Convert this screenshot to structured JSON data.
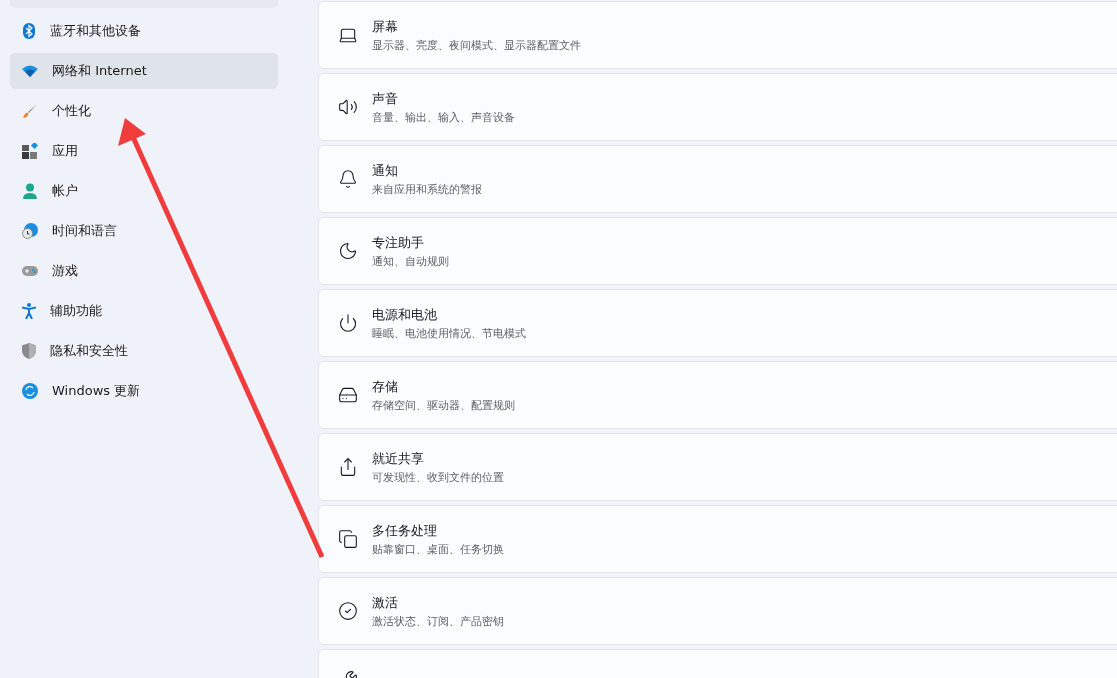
{
  "sidebar": {
    "items": [
      {
        "label": "蓝牙和其他设备",
        "selected": false
      },
      {
        "label": "网络和 Internet",
        "selected": true
      },
      {
        "label": "个性化",
        "selected": false
      },
      {
        "label": "应用",
        "selected": false
      },
      {
        "label": "帐户",
        "selected": false
      },
      {
        "label": "时间和语言",
        "selected": false
      },
      {
        "label": "游戏",
        "selected": false
      },
      {
        "label": "辅助功能",
        "selected": false
      },
      {
        "label": "隐私和安全性",
        "selected": false
      },
      {
        "label": "Windows 更新",
        "selected": false
      }
    ]
  },
  "settings": [
    {
      "title": "屏幕",
      "subtitle": "显示器、亮度、夜间模式、显示器配置文件"
    },
    {
      "title": "声音",
      "subtitle": "音量、输出、输入、声音设备"
    },
    {
      "title": "通知",
      "subtitle": "来自应用和系统的警报"
    },
    {
      "title": "专注助手",
      "subtitle": "通知、自动规则"
    },
    {
      "title": "电源和电池",
      "subtitle": "睡眠、电池使用情况、节电模式"
    },
    {
      "title": "存储",
      "subtitle": "存储空间、驱动器、配置规则"
    },
    {
      "title": "就近共享",
      "subtitle": "可发现性、收到文件的位置"
    },
    {
      "title": "多任务处理",
      "subtitle": "贴靠窗口、桌面、任务切换"
    },
    {
      "title": "激活",
      "subtitle": "激活状态、订阅、产品密钥"
    }
  ]
}
